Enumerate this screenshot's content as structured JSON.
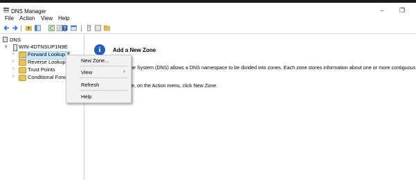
{
  "window": {
    "title": "DNS Manager",
    "minimize_glyph": "–",
    "restore_glyph": "❐"
  },
  "menubar": {
    "items": [
      "File",
      "Action",
      "View",
      "Help"
    ]
  },
  "toolbar": {
    "icons": [
      "back-arrow-icon",
      "forward-arrow-icon",
      "up-folder-icon",
      "show-hide-console-tree-icon",
      "refresh-icon",
      "export-list-icon",
      "help-icon",
      "properties-icon",
      "server-list-icon",
      "zone-icon",
      "folder-icon"
    ]
  },
  "tree": {
    "root": "DNS",
    "server": "WIN-4DTNSUP1N9E",
    "children": [
      "Forward Lookup Z",
      "Reverse Lookup Z",
      "Trust Points",
      "Conditional Forw"
    ]
  },
  "panel": {
    "title": "Add a New Zone",
    "line1": "me System (DNS) allows a DNS namespace to be divided into zones. Each zone stores information about one or more contiguous",
    "line2": "ne, on the Action menu, click New Zone."
  },
  "context_menu": {
    "items": [
      "New Zone...",
      "View",
      "Refresh",
      "Help"
    ],
    "submenu_arrow": "›"
  },
  "colors": {
    "selection": "#cce8ff",
    "folder": "#e8c35a",
    "info_blue": "#1f5fbf"
  }
}
